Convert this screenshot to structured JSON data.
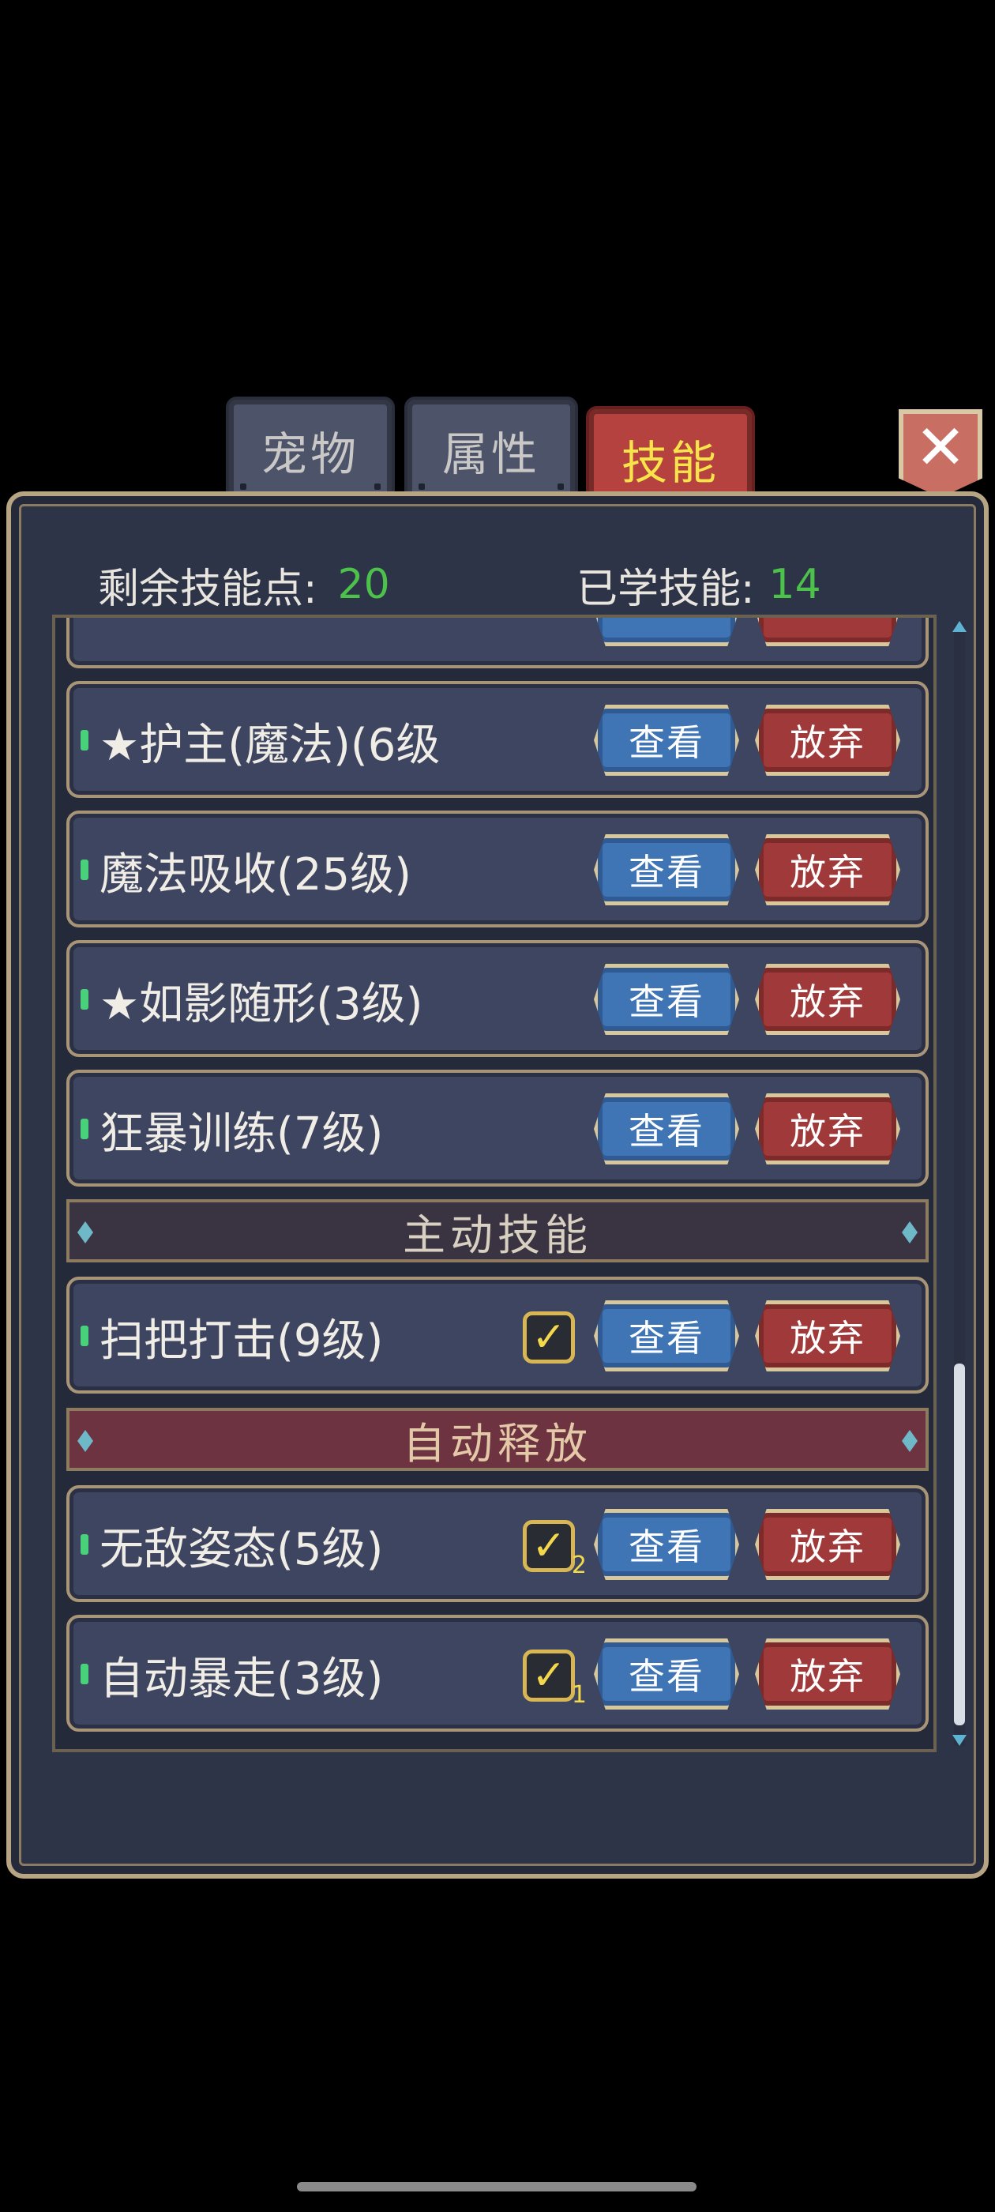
{
  "tabs": [
    {
      "label": "宠物",
      "active": false
    },
    {
      "label": "属性",
      "active": false
    },
    {
      "label": "技能",
      "active": true
    }
  ],
  "close_label": "✕",
  "stats": {
    "remaining_label": "剩余技能点:",
    "remaining_value": "20",
    "learned_label": "已学技能:",
    "learned_value": "14"
  },
  "buttons": {
    "view": "查看",
    "drop": "放弃"
  },
  "skills": [
    {
      "name": "★护主(魔法)(6级"
    },
    {
      "name": "魔法吸收(25级)"
    },
    {
      "name": "★如影随形(3级)"
    },
    {
      "name": "狂暴训练(7级)"
    }
  ],
  "sections": {
    "active": "主动技能",
    "auto": "自动释放"
  },
  "active_skills": [
    {
      "name": "扫把打击(9级)",
      "checked": true,
      "order": ""
    }
  ],
  "auto_skills": [
    {
      "name": "无敌姿态(5级)",
      "checked": true,
      "order": "2"
    },
    {
      "name": "自动暴走(3级)",
      "checked": true,
      "order": "1"
    }
  ],
  "colors": {
    "accent_green": "#4cc24a",
    "view_blue": "#3f74b5",
    "drop_red": "#a03a3a",
    "tab_active": "#b5423f"
  }
}
